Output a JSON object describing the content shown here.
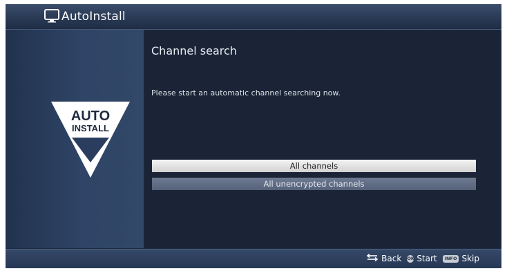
{
  "header": {
    "title": "AutoInstall",
    "icon": "tv-icon"
  },
  "sidebar": {
    "logo_line1": "AUTO",
    "logo_line2": "INSTALL",
    "logo_icon": "auto-install-logo"
  },
  "main": {
    "title": "Channel search",
    "prompt": "Please start an automatic channel searching now.",
    "options": [
      {
        "label": "All channels",
        "selected": true
      },
      {
        "label": "All unencrypted channels",
        "selected": false
      }
    ]
  },
  "footer": {
    "back_label": "Back",
    "ok_key": "OK",
    "start_label": "Start",
    "info_key": "INFO",
    "skip_label": "Skip"
  },
  "colors": {
    "background": "#1d2a3f",
    "header": "#2a3a55",
    "selected_option": "#e6e6e6",
    "unselected_option": "#5f6c84"
  }
}
